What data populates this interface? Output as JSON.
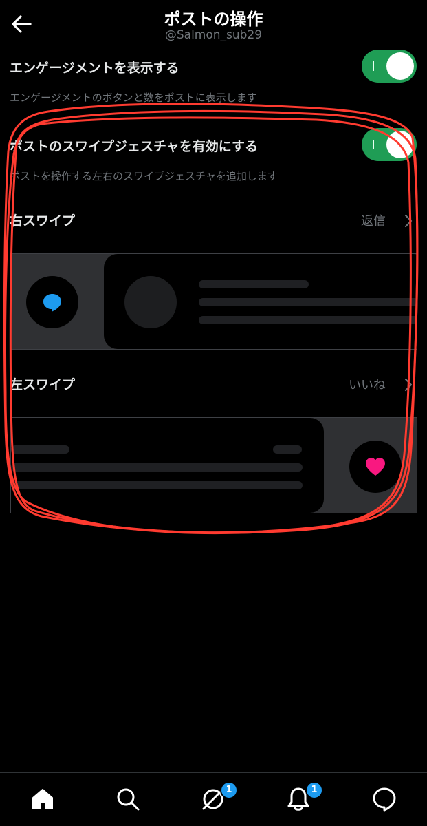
{
  "header": {
    "title": "ポストの操作",
    "account": "@Salmon_sub29",
    "back_icon": "arrow-left-icon"
  },
  "settings": {
    "engagement": {
      "label": "エンゲージメントを表示する",
      "description": "エンゲージメントのボタンと数をポストに表示します",
      "enabled": true
    },
    "swipe_gestures": {
      "label": "ポストのスワイプジェスチャを有効にする",
      "description": "ポストを操作する左右のスワイプジェスチャを追加します",
      "enabled": true
    },
    "right_swipe": {
      "label": "右スワイプ",
      "value": "返信",
      "preview_icon": "reply-bubble-icon"
    },
    "left_swipe": {
      "label": "左スワイプ",
      "value": "いいね",
      "preview_icon": "heart-icon"
    }
  },
  "tabbar": {
    "items": [
      {
        "name": "home",
        "icon": "home-icon"
      },
      {
        "name": "search",
        "icon": "search-icon"
      },
      {
        "name": "grok",
        "icon": "grok-icon",
        "badge": "1"
      },
      {
        "name": "notifications",
        "icon": "bell-icon",
        "badge": "1"
      },
      {
        "name": "messages",
        "icon": "message-icon"
      }
    ]
  },
  "colors": {
    "background": "#000000",
    "toggle_on": "#1f9d55",
    "secondary_text": "#71767b",
    "reply_icon": "#1d9bf0",
    "like_icon": "#f91880",
    "annotation": "#ff3b30",
    "badge": "#1d9bf0"
  }
}
